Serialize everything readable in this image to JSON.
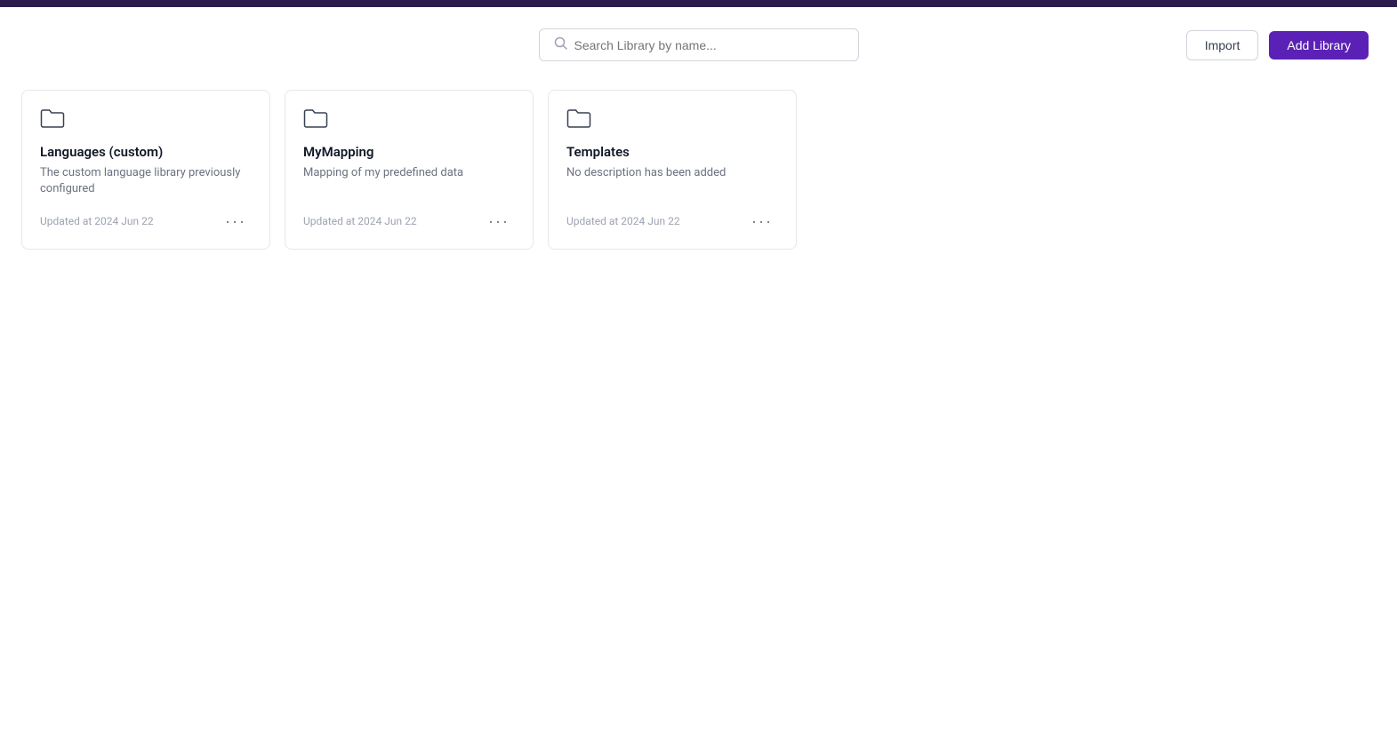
{
  "topbar": {
    "color": "#2d1b4e"
  },
  "header": {
    "search": {
      "placeholder": "Search Library by name..."
    },
    "import_label": "Import",
    "add_library_label": "Add Library"
  },
  "cards": [
    {
      "id": "languages-custom",
      "title": "Languages (custom)",
      "description": "The custom language library previously configured",
      "updated": "Updated at 2024 Jun 22"
    },
    {
      "id": "mymapping",
      "title": "MyMapping",
      "description": "Mapping of my predefined data",
      "updated": "Updated at 2024 Jun 22"
    },
    {
      "id": "templates",
      "title": "Templates",
      "description": "No description has been added",
      "updated": "Updated at 2024 Jun 22"
    }
  ]
}
